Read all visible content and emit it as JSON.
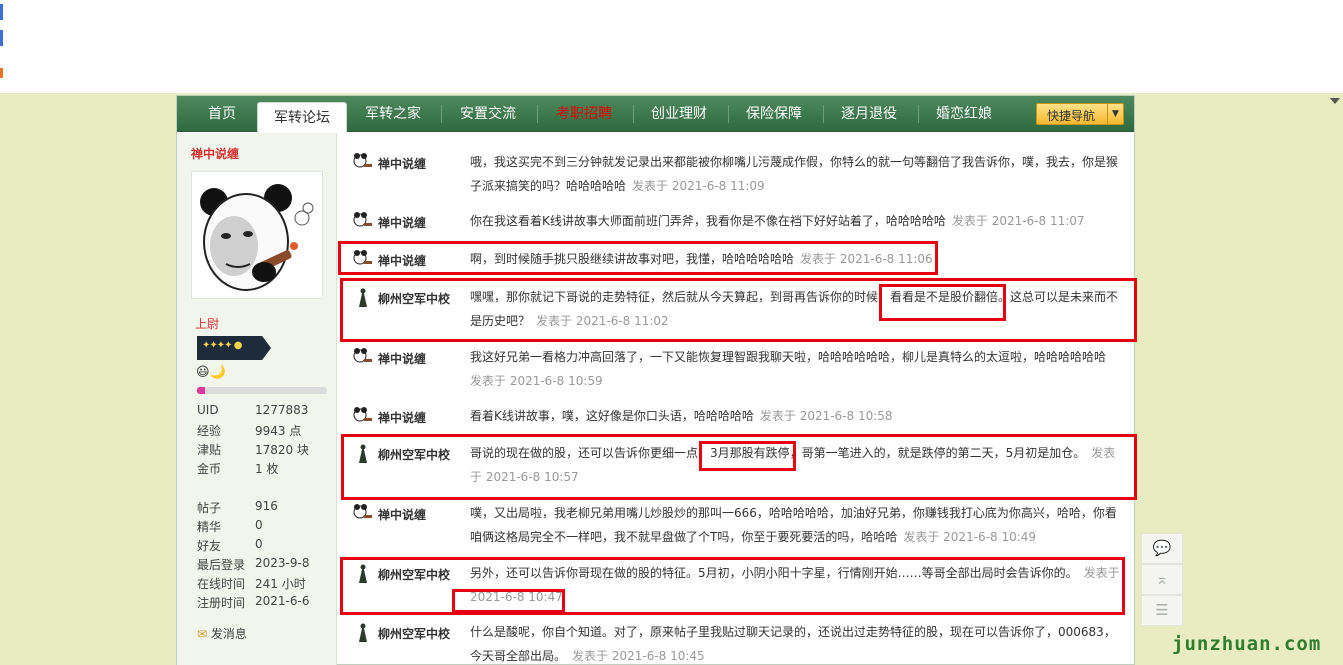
{
  "nav": {
    "items": [
      {
        "label": "首页"
      },
      {
        "label": "军转论坛"
      },
      {
        "label": "军转之家"
      },
      {
        "label": "安置交流"
      },
      {
        "label": "考职招聘"
      },
      {
        "label": "创业理财"
      },
      {
        "label": "保险保障"
      },
      {
        "label": "逐月退役"
      },
      {
        "label": "婚恋红娘"
      }
    ],
    "quick_nav_label": "快捷导航",
    "active_color": "#ffffff",
    "red_item_color": "#e60000"
  },
  "sidebar": {
    "username": "禅中说缠",
    "rank": "上尉",
    "emoji": "😃🌙",
    "progress_fraction": 0.06,
    "stats": [
      {
        "key": "UID",
        "value": "1277883"
      },
      {
        "key": "经验",
        "value": "9943 点"
      },
      {
        "key": "津贴",
        "value": "17820 块"
      },
      {
        "key": "金币",
        "value": "1 枚"
      }
    ],
    "stats2": [
      {
        "key": "帖子",
        "value": "916"
      },
      {
        "key": "精华",
        "value": "0"
      },
      {
        "key": "好友",
        "value": "0"
      },
      {
        "key": "最后登录",
        "value": "2023-9-8"
      },
      {
        "key": "在线时间",
        "value": "241 小时"
      },
      {
        "key": "注册时间",
        "value": "2021-6-6"
      }
    ],
    "send_message": "发消息"
  },
  "posts": [
    {
      "author": "禅中说缠",
      "text": "哦，我这买完不到三分钟就发记录出来都能被你柳嘴儿污蔑成作假，你特么的就一句等翻倍了我告诉你，噗，我去，你是猴子派来搞笑的吗？哈哈哈哈哈",
      "time": "发表于 2021-6-8 11:09"
    },
    {
      "author": "禅中说缠",
      "text": "你在我这看着K线讲故事大师面前班门弄斧，我看你是不像在裆下好好站着了，哈哈哈哈哈",
      "time": "发表于 2021-6-8 11:07"
    },
    {
      "author": "禅中说缠",
      "text": "啊，到时候随手挑只股继续讲故事对吧，我懂，哈哈哈哈哈哈",
      "time": "发表于 2021-6-8 11:06"
    },
    {
      "author": "柳州空军中校",
      "text": "嘿嘿，那你就记下哥说的走势特征，然后就从今天算起，到哥再告诉你的时候，看看是不是股价翻倍。这总可以是未来而不是历史吧？",
      "time": "发表于 2021-6-8 11:02"
    },
    {
      "author": "禅中说缠",
      "text": "我这好兄弟一看格力冲高回落了，一下又能恢复理智跟我聊天啦，哈哈哈哈哈哈，柳儿是真特么的太逗啦，哈哈哈哈哈哈",
      "time": "发表于 2021-6-8 10:59"
    },
    {
      "author": "禅中说缠",
      "text": "看着K线讲故事，噗，这好像是你口头语，哈哈哈哈哈",
      "time": "发表于 2021-6-8 10:58"
    },
    {
      "author": "柳州空军中校",
      "text": "哥说的现在做的股，还可以告诉你更细一点，3月那股有跌停，哥第一笔进入的，就是跌停的第二天，5月初是加仓。",
      "time": "发表于 2021-6-8 10:57"
    },
    {
      "author": "禅中说缠",
      "text": "噗，又出局啦，我老柳兄弟用嘴儿炒股炒的那叫一666，哈哈哈哈哈，加油好兄弟，你赚钱我打心底为你高兴，哈哈，你看咱俩这格局完全不一样吧，我不就早盘做了个T吗，你至于要死要活的吗，哈哈哈",
      "time": "发表于 2021-6-8 10:49"
    },
    {
      "author": "柳州空军中校",
      "text": "另外，还可以告诉你哥现在做的股的特征。5月初，小阴小阳十字星，行情刚开始……等哥全部出局时会告诉你的。",
      "time": "发表于 2021-6-8 10:47"
    },
    {
      "author": "柳州空军中校",
      "text": "什么是酸呢，你自个知道。对了，原来帖子里我贴过聊天记录的，还说出过走势特征的股，现在可以告诉你了，000683，今天哥全部出局。",
      "time": "发表于 2021-6-8 10:45"
    }
  ],
  "watermark": "junzhuan.com",
  "colors": {
    "highlight": "#e4000f",
    "nav_green": "#2f6a40",
    "author_red": "#d43030"
  }
}
